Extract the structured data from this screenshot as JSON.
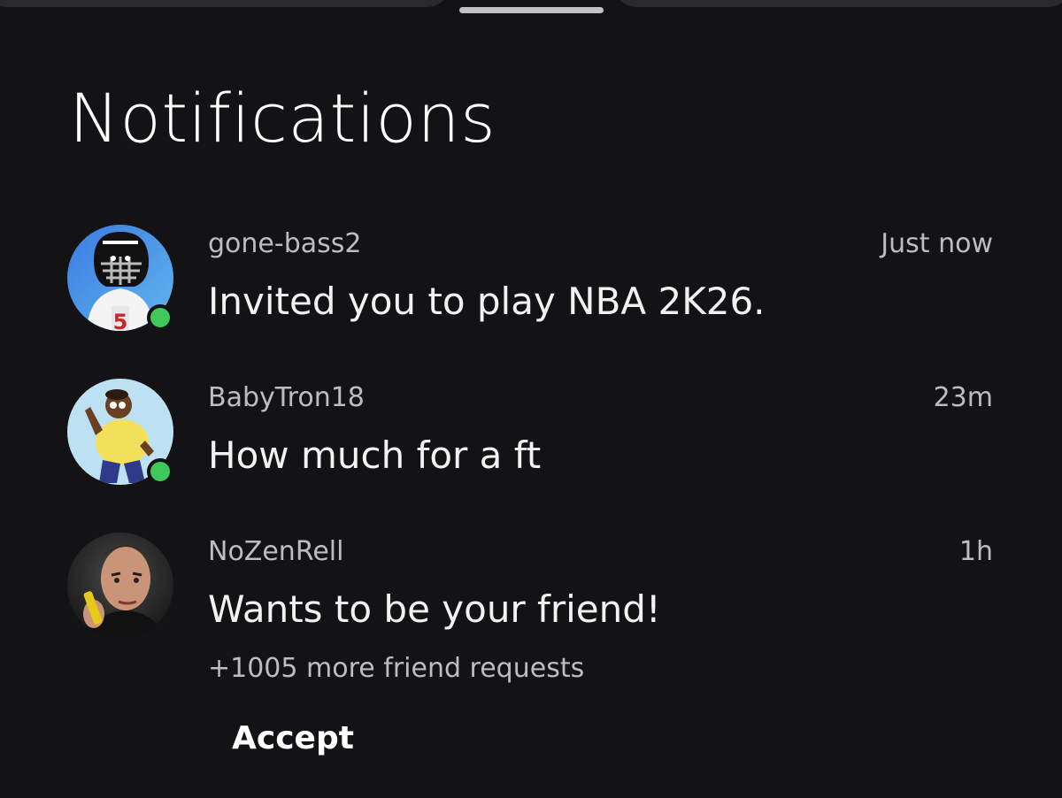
{
  "header": {
    "title": "Notifications"
  },
  "notifications": [
    {
      "username": "gone-bass2",
      "time": "Just now",
      "message": "Invited you to play NBA 2K26.",
      "online": true,
      "avatar_icon": "football-player-avatar-icon"
    },
    {
      "username": "BabyTron18",
      "time": "23m",
      "message": "How much for a ft",
      "online": true,
      "avatar_icon": "cartoon-character-avatar-icon"
    },
    {
      "username": "NoZenRell",
      "time": "1h",
      "message": "Wants to be your friend!",
      "online": false,
      "avatar_icon": "man-photo-avatar-icon",
      "more_text": "+1005 more friend requests"
    }
  ],
  "actions": {
    "accept_label": "Accept"
  },
  "colors": {
    "background": "#131315",
    "presence_online": "#3ec95a",
    "secondary_text": "#bdbdc1"
  }
}
